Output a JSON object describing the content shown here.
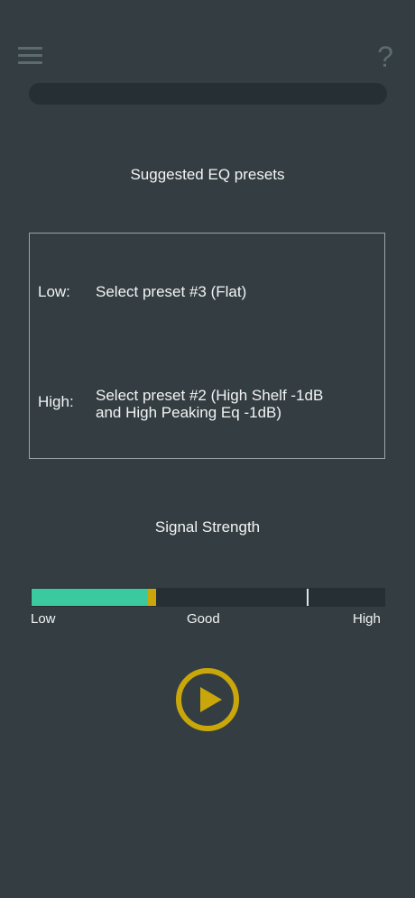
{
  "header": {
    "menu_icon": "hamburger-menu-icon",
    "help_icon": "question-mark-icon",
    "help_glyph": "?"
  },
  "progress": {
    "value": 0
  },
  "eq": {
    "title": "Suggested EQ presets",
    "low": {
      "label": "Low:",
      "value": "Select preset #3 (Flat)"
    },
    "high": {
      "label": "High:",
      "value": "Select preset #2 (High Shelf -1dB\nand High Peaking Eq -1dB)"
    }
  },
  "signal": {
    "title": "Signal Strength",
    "level": 0.33,
    "peak": 0.345,
    "target": 0.78,
    "labels": {
      "low": "Low",
      "good": "Good",
      "high": "High"
    },
    "colors": {
      "level": "#3bc9a0",
      "peak": "#c9a70b",
      "target": "#dfe3e4"
    }
  },
  "controls": {
    "play_icon": "play-icon",
    "play_color": "#c9a70b"
  }
}
